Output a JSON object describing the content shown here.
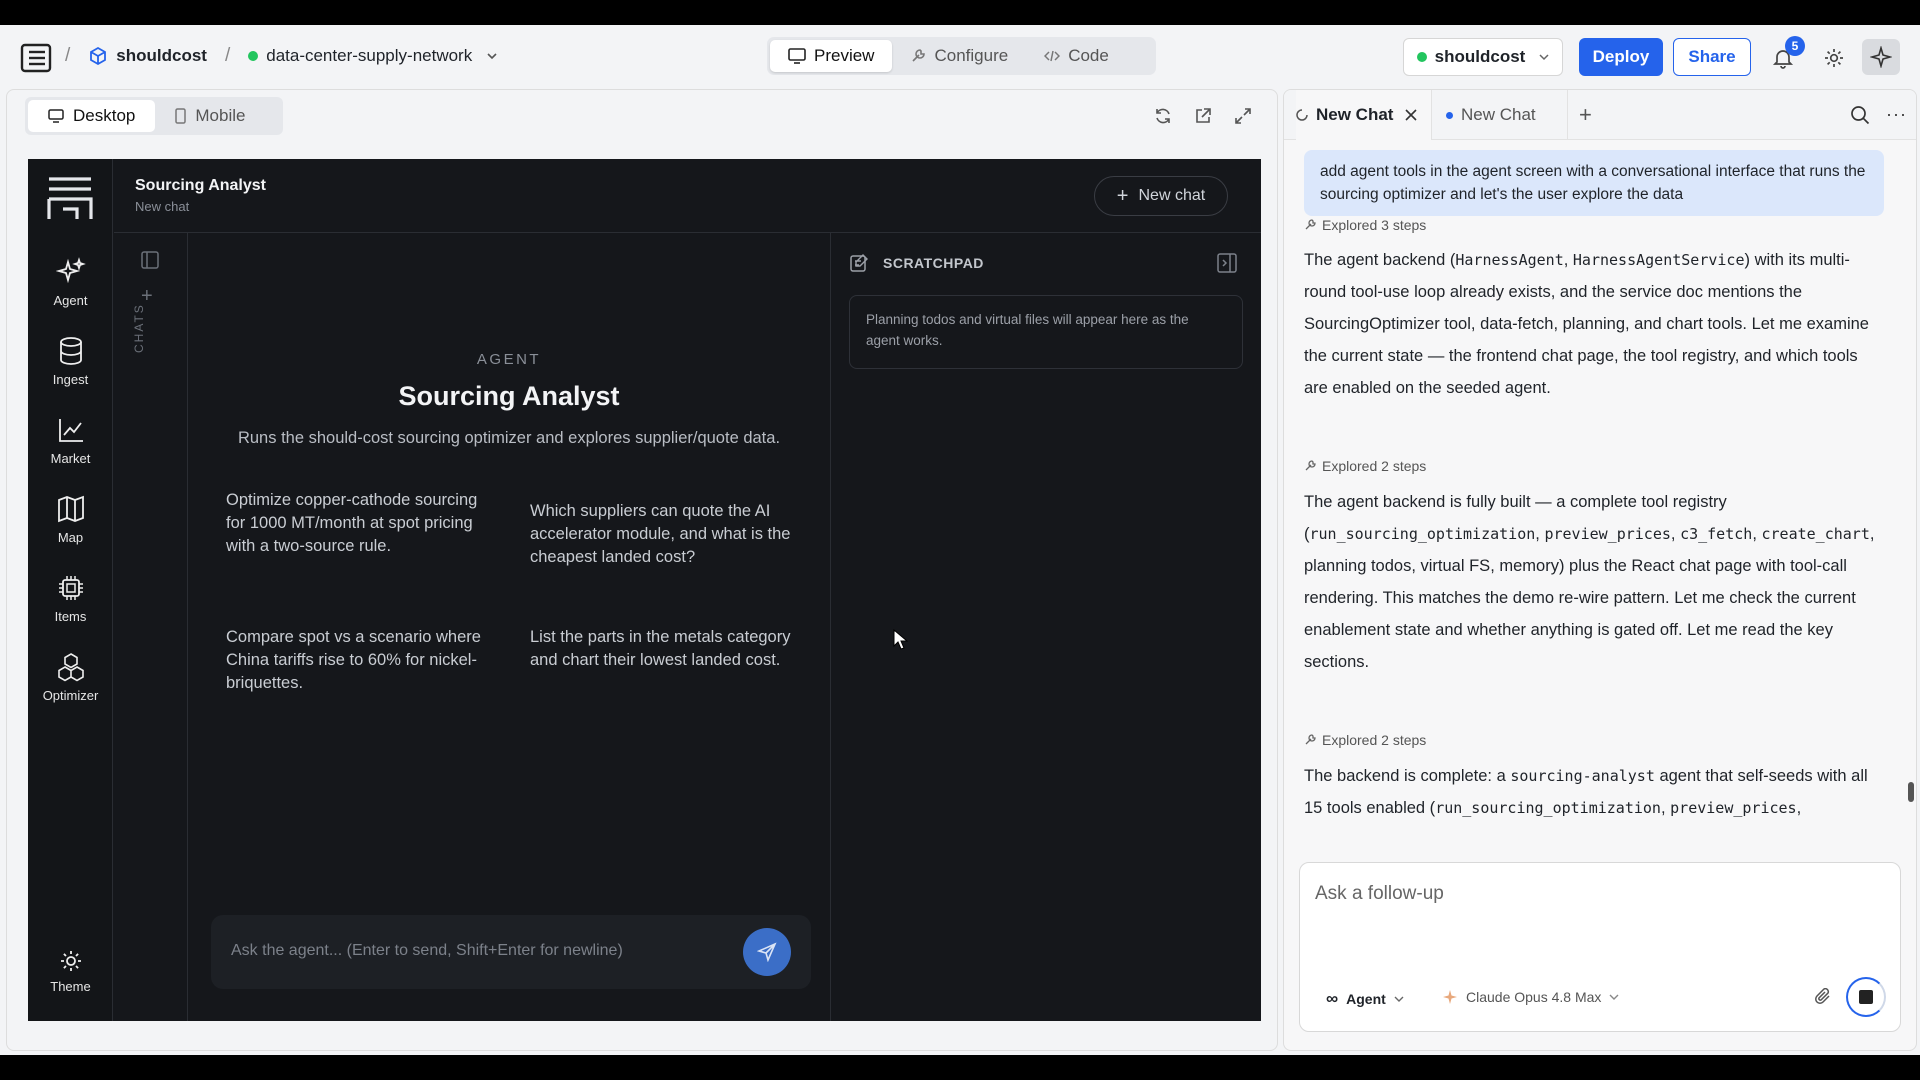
{
  "topbar": {
    "org": "shouldcost",
    "project": "data-center-supply-network",
    "tabs": [
      "Preview",
      "Configure",
      "Code"
    ],
    "env": "shouldcost",
    "deploy": "Deploy",
    "share": "Share",
    "notifications": "5"
  },
  "preview": {
    "modes": [
      "Desktop",
      "Mobile"
    ]
  },
  "app": {
    "nav": [
      "Agent",
      "Ingest",
      "Market",
      "Map",
      "Items",
      "Optimizer"
    ],
    "theme": "Theme",
    "title": "Sourcing Analyst",
    "subtitle": "New chat",
    "new_chat": "New chat",
    "chats_label": "CHATS",
    "agent_kicker": "AGENT",
    "agent_name": "Sourcing Analyst",
    "agent_desc": "Runs the should-cost sourcing optimizer and explores supplier/quote data.",
    "suggestions": [
      "Optimize copper-cathode sourcing for 1000 MT/month at spot pricing with a two-source rule.",
      "Which suppliers can quote the AI accelerator module, and what is the cheapest landed cost?",
      "Compare spot vs a scenario where China tariffs rise to 60% for nickel-briquettes.",
      "List the parts in the metals category and chart their lowest landed cost."
    ],
    "input_placeholder": "Ask the agent...  (Enter to send, Shift+Enter for newline)",
    "scratchpad_title": "SCRATCHPAD",
    "scratchpad_empty": "Planning todos and virtual files will appear here as the agent works."
  },
  "chat": {
    "tabs": [
      "New Chat",
      "New Chat"
    ],
    "user_message": "add agent tools in the agent screen with a conversational interface that runs the sourcing optimizer and let's the user explore the data",
    "explored": [
      "Explored 3 steps",
      "Explored 2 steps",
      "Explored 2 steps"
    ],
    "composer_placeholder": "Ask a follow-up",
    "mode": "Agent",
    "model": "Claude Opus 4.8 Max"
  },
  "colors": {
    "accent": "#2563eb",
    "dark_bg": "#15171b",
    "status_green": "#22c55e"
  }
}
